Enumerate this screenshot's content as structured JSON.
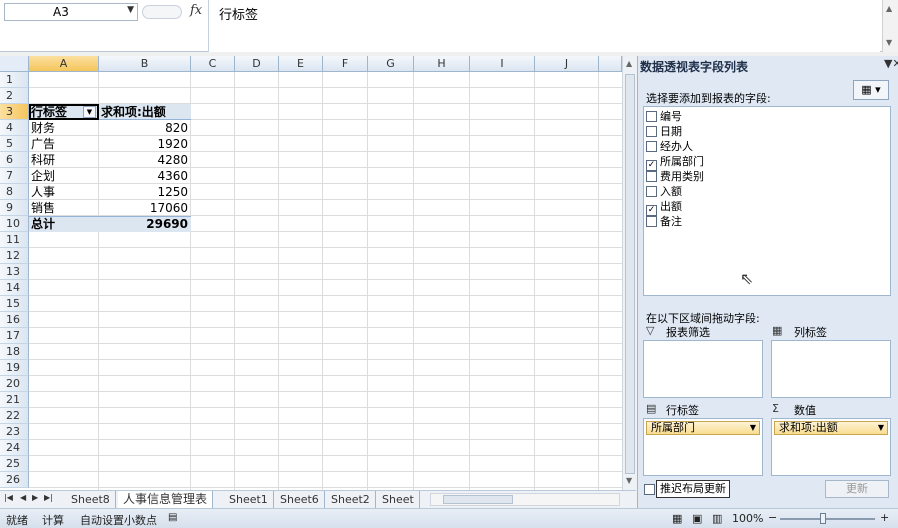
{
  "formula_bar": {
    "name_box": "A3",
    "fx": "fx",
    "formula": "行标签"
  },
  "columns": [
    "A",
    "B",
    "C",
    "D",
    "E",
    "F",
    "G",
    "H",
    "I",
    "J"
  ],
  "rows": [
    "1",
    "2",
    "3",
    "4",
    "5",
    "6",
    "7",
    "8",
    "9",
    "10",
    "11",
    "12",
    "13",
    "14",
    "15",
    "16",
    "17",
    "18",
    "19",
    "20",
    "21",
    "22",
    "23",
    "24",
    "25",
    "26"
  ],
  "pivot": {
    "header_label": "行标签",
    "header_value": "求和项:出额",
    "items": [
      {
        "label": "财务",
        "value": "820"
      },
      {
        "label": "广告",
        "value": "1920"
      },
      {
        "label": "科研",
        "value": "4280"
      },
      {
        "label": "企划",
        "value": "4360"
      },
      {
        "label": "人事",
        "value": "1250"
      },
      {
        "label": "销售",
        "value": "17060"
      }
    ],
    "total_label": "总计",
    "total_value": "29690"
  },
  "sheet_tabs": [
    "Sheet8",
    "人事信息管理表",
    "Sheet1",
    "Sheet6",
    "Sheet2",
    "Sheet"
  ],
  "status": {
    "ready": "就绪",
    "calc": "计算",
    "auto_decimal": "自动设置小数点",
    "zoom": "100%"
  },
  "panel": {
    "title": "数据透视表字段列表",
    "choose_label": "选择要添加到报表的字段:",
    "fields": [
      {
        "name": "编号",
        "checked": false
      },
      {
        "name": "日期",
        "checked": false
      },
      {
        "name": "经办人",
        "checked": false
      },
      {
        "name": "所属部门",
        "checked": true
      },
      {
        "name": "费用类别",
        "checked": false
      },
      {
        "name": "入额",
        "checked": false
      },
      {
        "name": "出额",
        "checked": true
      },
      {
        "name": "备注",
        "checked": false
      }
    ],
    "drag_label": "在以下区域间拖动字段:",
    "report_filter": "报表筛选",
    "column_labels": "列标签",
    "row_labels": "行标签",
    "values": "数值",
    "row_field": "所属部门",
    "value_field": "求和项:出额",
    "defer_label": "推迟布局更新",
    "update_button": "更新"
  }
}
